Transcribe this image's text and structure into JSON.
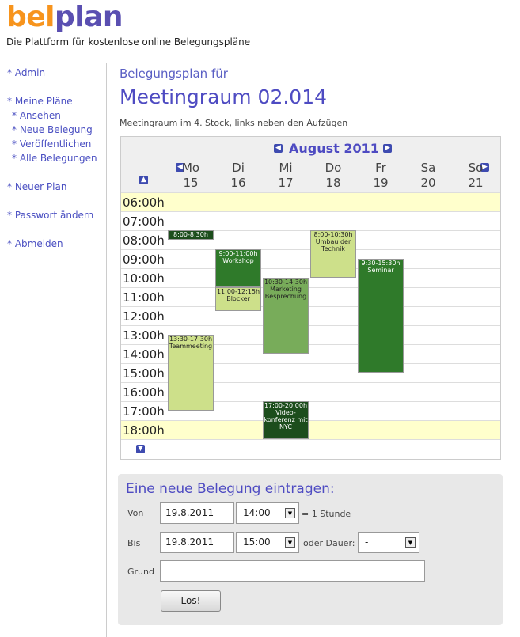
{
  "brand": {
    "logo_part1": "bel",
    "logo_part2": "plan",
    "tagline": "Die Plattform für kostenlose online Belegungspläne"
  },
  "sidebar": {
    "admin": "* Admin",
    "meine_plaene": "* Meine Pläne",
    "ansehen": "* Ansehen",
    "neue_belegung": "* Neue Belegung",
    "veroeffentlichen": "* Veröffentlichen",
    "alle_belegungen": "* Alle Belegungen",
    "neuer_plan": "* Neuer Plan",
    "passwort": "* Passwort ändern",
    "abmelden": "* Abmelden"
  },
  "page": {
    "crumb": "Belegungsplan für",
    "title": "Meetingraum 02.014",
    "subtitle": "Meetingraum im 4. Stock, links neben den Aufzügen"
  },
  "calendar": {
    "month": "August 2011",
    "days": [
      {
        "name": "Mo",
        "num": "15"
      },
      {
        "name": "Di",
        "num": "16"
      },
      {
        "name": "Mi",
        "num": "17"
      },
      {
        "name": "Do",
        "num": "18"
      },
      {
        "name": "Fr",
        "num": "19"
      },
      {
        "name": "Sa",
        "num": "20"
      },
      {
        "name": "So",
        "num": "21"
      }
    ],
    "hours": [
      "06:00h",
      "07:00h",
      "08:00h",
      "09:00h",
      "10:00h",
      "11:00h",
      "12:00h",
      "13:00h",
      "14:00h",
      "15:00h",
      "16:00h",
      "17:00h",
      "18:00h"
    ],
    "events": [
      {
        "day": 0,
        "start": 8.0,
        "end": 8.5,
        "time": "8:00-8:30h",
        "title": "",
        "tone": "dark"
      },
      {
        "day": 0,
        "start": 13.5,
        "end": 17.5,
        "time": "13:30-17:30h",
        "title": "Teammeeting",
        "tone": "light"
      },
      {
        "day": 1,
        "start": 9.0,
        "end": 11.0,
        "time": "9:00-11:00h",
        "title": "Workshop",
        "tone": "medium"
      },
      {
        "day": 1,
        "start": 11.0,
        "end": 12.25,
        "time": "11:00-12:15h",
        "title": "Blocker",
        "tone": "light"
      },
      {
        "day": 2,
        "start": 10.5,
        "end": 14.5,
        "time": "10:30-14:30h",
        "title": "Marketing Besprechung",
        "tone": "green"
      },
      {
        "day": 2,
        "start": 17.0,
        "end": 20.0,
        "time": "17:00-20:00h",
        "title": "Video-konferenz mit NYC",
        "tone": "dark"
      },
      {
        "day": 3,
        "start": 8.0,
        "end": 10.5,
        "time": "8:00-10:30h",
        "title": "Umbau der Technik",
        "tone": "light"
      },
      {
        "day": 4,
        "start": 9.5,
        "end": 15.5,
        "time": "9:30-15:30h",
        "title": "Seminar",
        "tone": "medium"
      }
    ]
  },
  "form": {
    "title": "Eine neue Belegung eintragen:",
    "von_label": "Von",
    "von_date": "19.8.2011",
    "von_time": "14:00",
    "duration_text": "= 1 Stunde",
    "bis_label": "Bis",
    "bis_date": "19.8.2011",
    "bis_time": "15:00",
    "dauer_label": "oder Dauer:",
    "dauer_value": "-",
    "grund_label": "Grund",
    "grund_value": "",
    "submit": "Los!"
  }
}
